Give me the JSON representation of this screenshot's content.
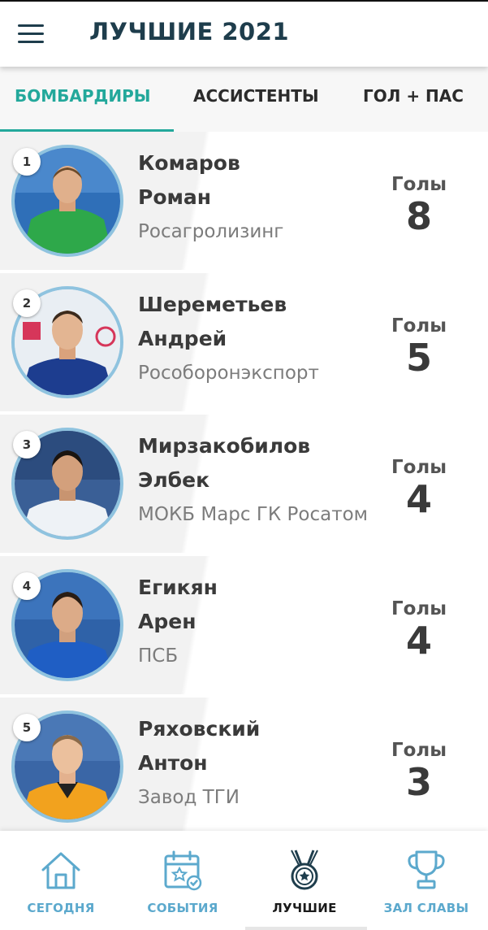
{
  "header": {
    "title": "ЛУЧШИЕ 2021",
    "menu_icon": "hamburger-menu-icon"
  },
  "tabs": [
    {
      "label": "БОМБАРДИРЫ",
      "active": true
    },
    {
      "label": "АССИСТЕНТЫ",
      "active": false
    },
    {
      "label": "ГОЛ + ПАС",
      "active": false
    }
  ],
  "colors": {
    "accent": "#23a89b",
    "title": "#1e3d4c",
    "nav": "#5ca9cd",
    "avatar_ring": "#8fc3df"
  },
  "players": [
    {
      "rank": "1",
      "first_line": "Комаров",
      "second_line": "Роман",
      "team": "Росагролизинг",
      "stat_label": "Голы",
      "stat_value": "8"
    },
    {
      "rank": "2",
      "first_line": "Шереметьев",
      "second_line": "Андрей",
      "team": "Рособоронэкспорт",
      "stat_label": "Голы",
      "stat_value": "5"
    },
    {
      "rank": "3",
      "first_line": "Мирзакобилов",
      "second_line": "Элбек",
      "team": "МОКБ Марс ГК Росатом",
      "stat_label": "Голы",
      "stat_value": "4"
    },
    {
      "rank": "4",
      "first_line": "Егикян",
      "second_line": "Арен",
      "team": "ПСБ",
      "stat_label": "Голы",
      "stat_value": "4"
    },
    {
      "rank": "5",
      "first_line": "Ряховский",
      "second_line": "Антон",
      "team": "Завод ТГИ",
      "stat_label": "Голы",
      "stat_value": "3"
    }
  ],
  "bottom_nav": [
    {
      "label": "СЕГОДНЯ",
      "icon": "home-icon",
      "active": false
    },
    {
      "label": "СОБЫТИЯ",
      "icon": "calendar-star-icon",
      "active": false
    },
    {
      "label": "ЛУЧШИЕ",
      "icon": "medal-icon",
      "active": true
    },
    {
      "label": "ЗАЛ СЛАВЫ",
      "icon": "trophy-icon",
      "active": false
    }
  ]
}
